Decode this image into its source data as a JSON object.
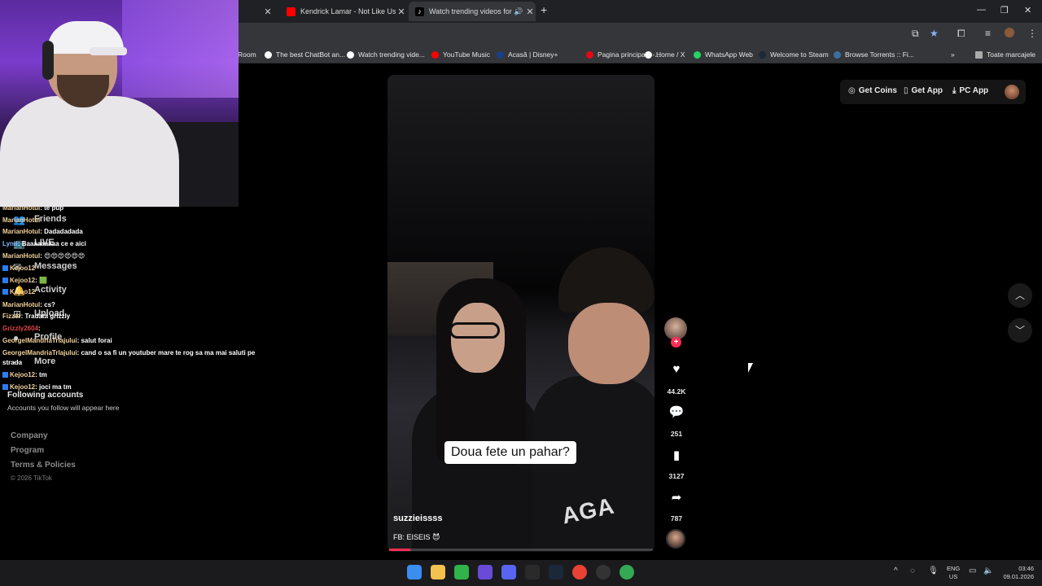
{
  "browser": {
    "tabs": [
      {
        "title": "",
        "favicon_color": "#ffffff"
      },
      {
        "title": "Kendrick Lamar - Not Like Us -",
        "favicon_color": "#ff0000"
      },
      {
        "title": "Watch trending videos for y",
        "favicon_color": "#ffffff"
      }
    ],
    "new_tab_glyph": "+",
    "bookmarks": [
      {
        "label": "Room",
        "color": "#888888"
      },
      {
        "label": "The best ChatBot an...",
        "color": "#ffffff"
      },
      {
        "label": "Watch trending vide...",
        "color": "#ffffff"
      },
      {
        "label": "YouTube Music",
        "color": "#ff0000"
      },
      {
        "label": "Acasă | Disney+",
        "color": "#1a3e8c"
      },
      {
        "label": "Pagina principală -...",
        "color": "#e50914"
      },
      {
        "label": "Home / X",
        "color": "#ffffff"
      },
      {
        "label": "WhatsApp Web",
        "color": "#25d366"
      },
      {
        "label": "Welcome to Steam",
        "color": "#1b2838"
      },
      {
        "label": "Browse Torrents :: Fi...",
        "color": "#3c6e9f"
      }
    ],
    "bookmarks_folder": "Toate marcajele"
  },
  "chat": [
    {
      "user": "MarianHotul",
      "msg": ": te pup",
      "style": "gold",
      "badge": false
    },
    {
      "user": "MarianHotul",
      "msg": "",
      "style": "gold",
      "badge": false
    },
    {
      "user": "MarianHotul",
      "msg": ": Dadadadada",
      "style": "gold",
      "badge": false
    },
    {
      "user": "Lynd",
      "msg": ": Baaaaaaaaa ce e aici",
      "style": "blue",
      "badge": false
    },
    {
      "user": "MarianHotul",
      "msg": ": 😍😍😍😍😍😍",
      "style": "gold",
      "badge": false
    },
    {
      "user": "Kejoo12",
      "msg": "",
      "style": "gold",
      "badge": true
    },
    {
      "user": "Kejoo12",
      "msg": ": 🟩",
      "style": "gold",
      "badge": true
    },
    {
      "user": "Kejoo12",
      "msg": "",
      "style": "gold",
      "badge": true
    },
    {
      "user": "MarianHotul",
      "msg": ": cs?",
      "style": "gold",
      "badge": false
    },
    {
      "user": "Fizzer",
      "msg": ": Tradata grizzly",
      "style": "gold",
      "badge": false
    },
    {
      "user": "Grizzly2604",
      "msg": ":",
      "style": "red",
      "badge": false
    },
    {
      "user": "GeorgelMandriaTrlajului",
      "msg": ": salut forai",
      "style": "gold",
      "badge": false
    },
    {
      "user": "GeorgelMandriaTrlajului",
      "msg": ": cand o sa fi un youtuber mare te rog sa ma mai saluti pe",
      "style": "gold",
      "badge": false
    },
    {
      "user": "",
      "msg": "strada",
      "style": "gold",
      "badge": false
    },
    {
      "user": "Kejoo12",
      "msg": ": tm",
      "style": "gold",
      "badge": true
    },
    {
      "user": "Kejoo12",
      "msg": ": joci ma tm",
      "style": "gold",
      "badge": true
    }
  ],
  "sidebar": {
    "items": [
      "Friends",
      "LIVE",
      "Messages",
      "Activity",
      "Upload",
      "Profile",
      "More"
    ],
    "following_heading": "Following accounts",
    "following_empty": "Accounts you follow will appear here",
    "footer": [
      "Company",
      "Program",
      "Terms & Policies"
    ],
    "copyright": "© 2026 TikTok"
  },
  "header": {
    "get_coins": "Get Coins",
    "get_app": "Get App",
    "pc_app": "PC App"
  },
  "video": {
    "caption": "Doua fete un pahar?",
    "username": "suzzieissss",
    "description": "FB: EISEIS 😈",
    "print_text": "AGA",
    "progress": 0.08
  },
  "actions": {
    "likes": "44.2K",
    "comments": "251",
    "saves": "3127",
    "shares": "787"
  },
  "taskbar": {
    "lang_top": "ENG",
    "lang_bottom": "US",
    "time": "03:46",
    "date": "09.01.2026"
  }
}
